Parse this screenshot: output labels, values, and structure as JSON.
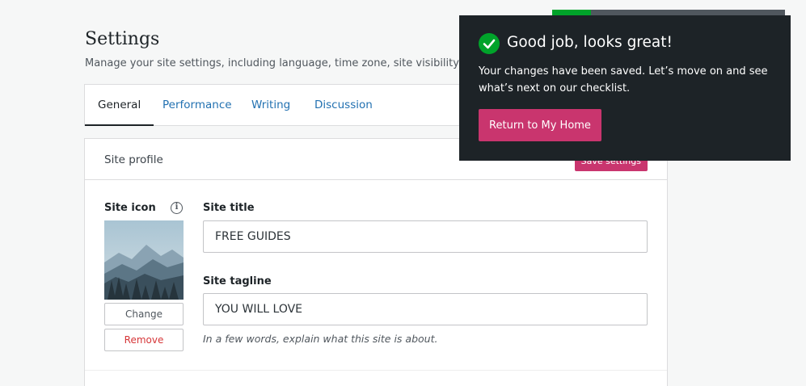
{
  "header": {
    "title": "Settings",
    "subtitle": "Manage your site settings, including language, time zone, site visibility, and"
  },
  "tabs": [
    {
      "label": "General",
      "active": true
    },
    {
      "label": "Performance",
      "active": false
    },
    {
      "label": "Writing",
      "active": false
    },
    {
      "label": "Discussion",
      "active": false
    }
  ],
  "site_profile": {
    "heading": "Site profile",
    "save_label": "Save settings",
    "site_icon_label": "Site icon",
    "info_icon": "i",
    "change_label": "Change",
    "remove_label": "Remove",
    "site_title_label": "Site title",
    "site_title_value": "FREE GUIDES",
    "site_tagline_label": "Site tagline",
    "site_tagline_value": "YOU WILL LOVE",
    "tagline_help": "In a few words, explain what this site is about."
  },
  "toast": {
    "icon": "checkmark-icon",
    "title": "Good job, looks great!",
    "body": "Your changes have been saved. Let’s move on and see what’s next on our checklist.",
    "button_label": "Return to My Home"
  },
  "colors": {
    "accent_pink": "#c9356e",
    "success_green": "#00a32a",
    "toast_bg": "#1d2327",
    "link_blue": "#2271b1"
  }
}
